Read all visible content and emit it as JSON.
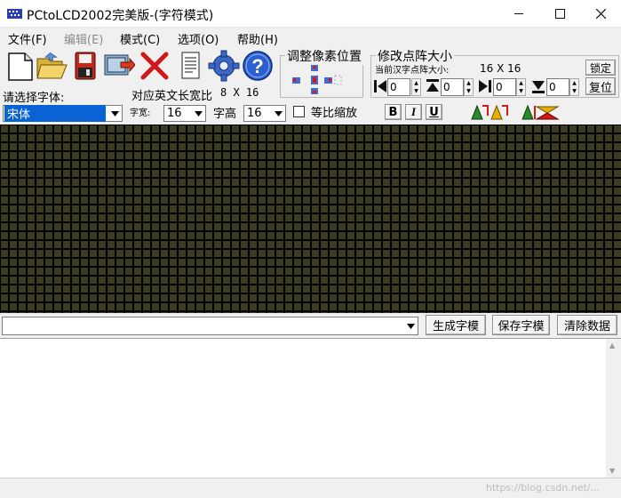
{
  "window": {
    "title": "PCtoLCD2002完美版-(字符模式)",
    "minimize": "—",
    "maximize": "☐",
    "close": "✕"
  },
  "menu": [
    {
      "label": "文件(F)",
      "enabled": true
    },
    {
      "label": "编辑(E)",
      "enabled": false
    },
    {
      "label": "模式(C)",
      "enabled": true
    },
    {
      "label": "选项(O)",
      "enabled": true
    },
    {
      "label": "帮助(H)",
      "enabled": true
    }
  ],
  "font_panel": {
    "select_font_label": "请选择字体:",
    "font_value": "宋体",
    "ratio_label": "对应英文长宽比",
    "ratio_value": "8 X 16",
    "width_label": "字宽:",
    "width_value": "16",
    "height_label": "字高",
    "height_value": "16",
    "proportional_label": "等比缩放"
  },
  "adjust_pixel": {
    "title": "调整像素位置"
  },
  "matrix_size": {
    "title": "修改点阵大小",
    "current_label": "当前汉字点阵大小:",
    "current_value": "16 X 16",
    "confirm_label": "锁定",
    "reset_label": "复位",
    "spin_values": [
      "0",
      "0",
      "0",
      "0"
    ]
  },
  "format_buttons": {
    "bold": "B",
    "italic": "I",
    "underline": "U"
  },
  "actions": {
    "generate": "生成字模",
    "save": "保存字模",
    "clear": "清除数据"
  },
  "input": {
    "value": ""
  },
  "output": {
    "text": ""
  },
  "watermark": "https://blog.csdn.net/..."
}
